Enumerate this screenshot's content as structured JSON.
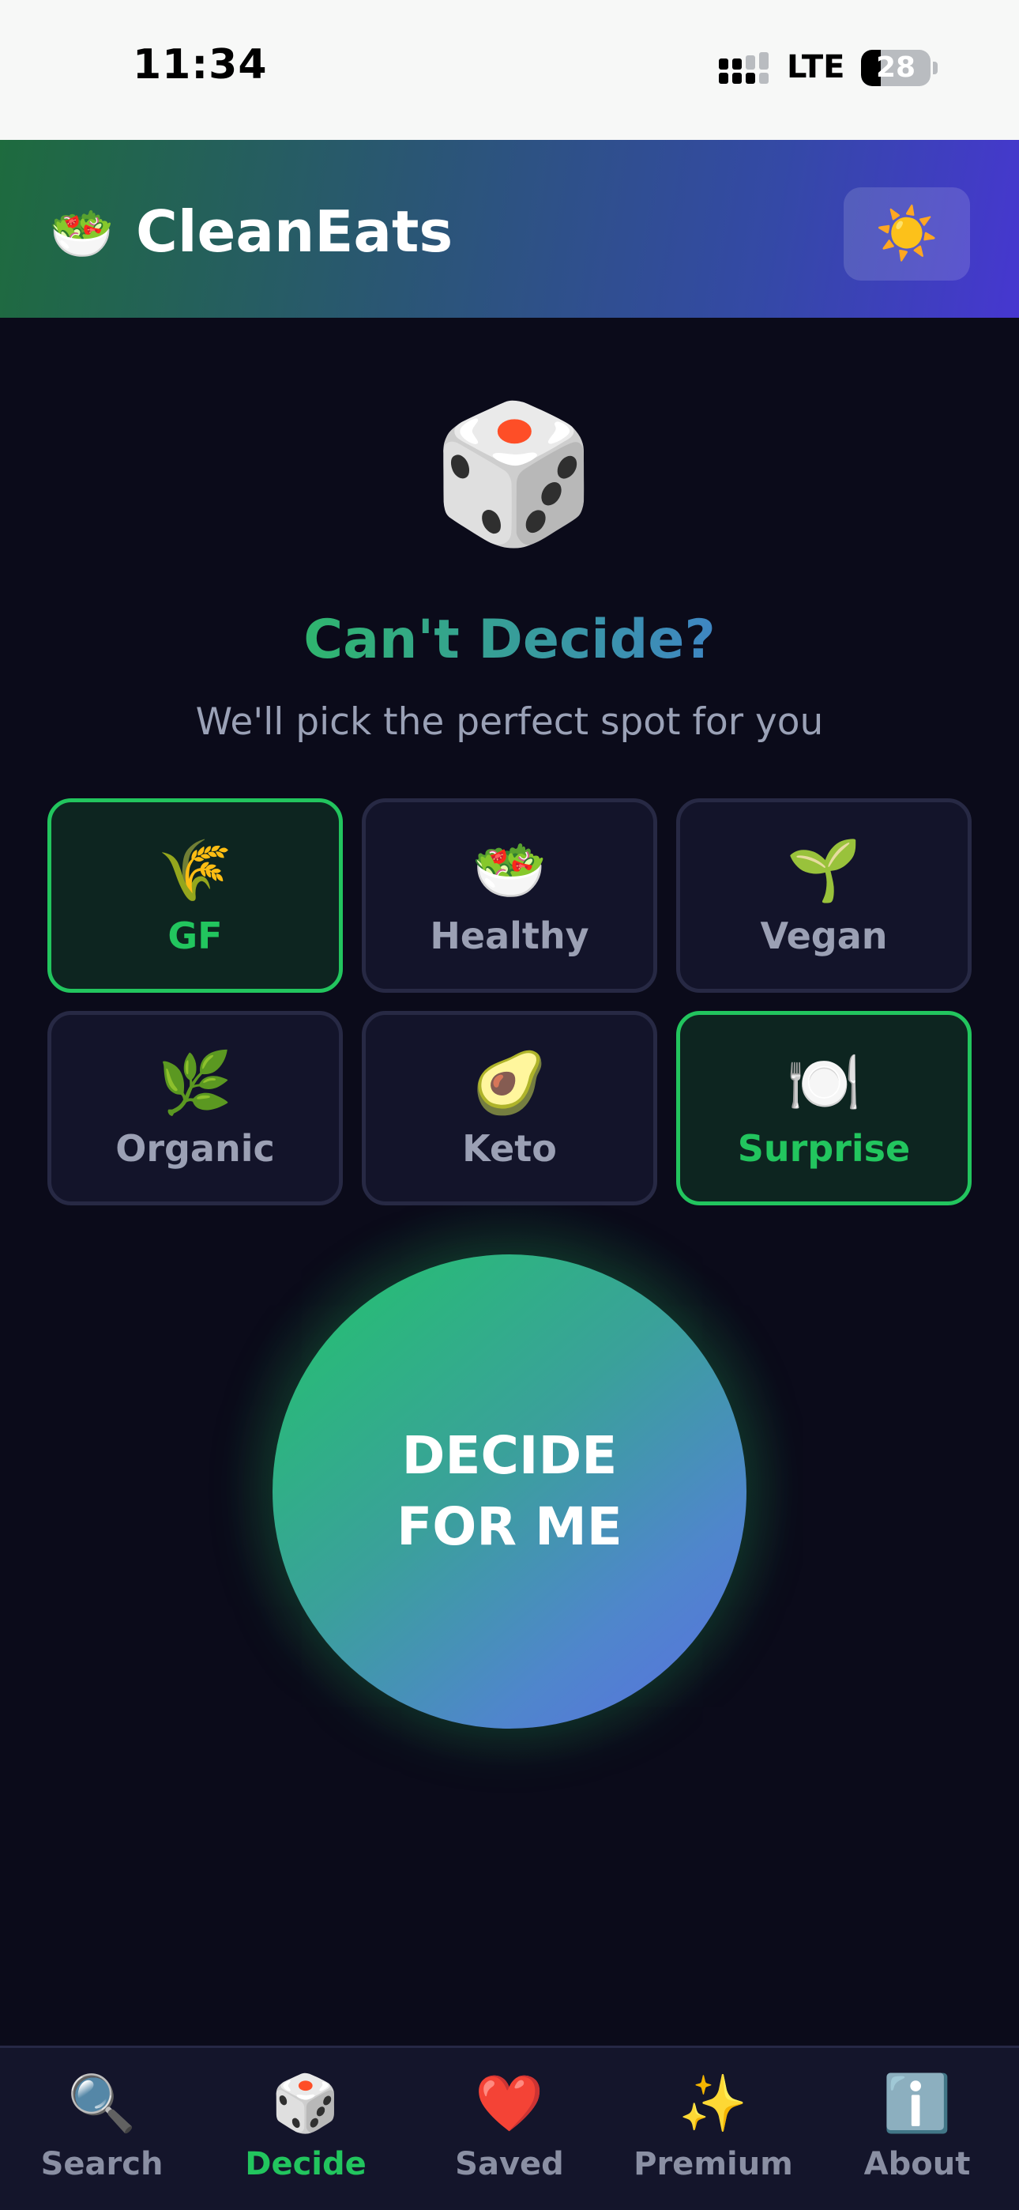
{
  "status_bar": {
    "time": "11:34",
    "network": "LTE",
    "battery_percent": "28",
    "battery_level": 0.28
  },
  "header": {
    "logo_icon": "🥗",
    "title": "CleanEats",
    "theme_icon": "☀️"
  },
  "hero": {
    "icon": "🎲",
    "headline": "Can't Decide?",
    "subheadline": "We'll pick the perfect spot for you"
  },
  "categories": [
    {
      "icon": "🌾",
      "label": "GF",
      "selected": true
    },
    {
      "icon": "🥗",
      "label": "Healthy",
      "selected": false
    },
    {
      "icon": "🌱",
      "label": "Vegan",
      "selected": false
    },
    {
      "icon": "🌿",
      "label": "Organic",
      "selected": false
    },
    {
      "icon": "🥑",
      "label": "Keto",
      "selected": true
    },
    {
      "icon": "🍽️",
      "label": "Surprise",
      "selected": true
    }
  ],
  "decide_button": {
    "line1": "DECIDE",
    "line2": "FOR ME"
  },
  "tabs": [
    {
      "icon": "🔍",
      "label": "Search",
      "active": false
    },
    {
      "icon": "🎲",
      "label": "Decide",
      "active": true
    },
    {
      "icon": "❤️",
      "label": "Saved",
      "active": false
    },
    {
      "icon": "✨",
      "label": "Premium",
      "active": false
    },
    {
      "icon": "ℹ️",
      "label": "About",
      "active": false
    }
  ],
  "colors": {
    "accent": "#22c55e",
    "background": "#0b0b1a",
    "card": "#13142a"
  }
}
